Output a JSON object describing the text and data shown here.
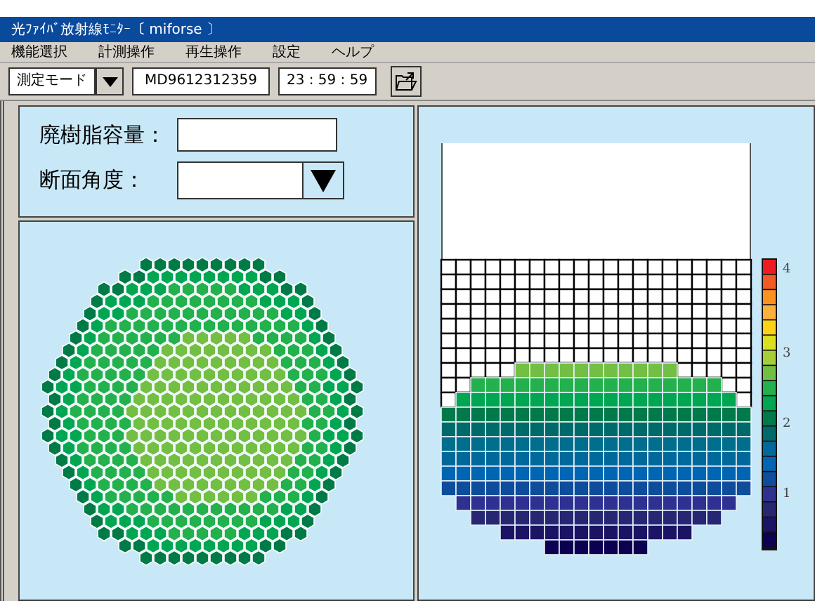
{
  "window": {
    "title": "光ﾌｧｲﾊﾞ放射線ﾓﾆﾀｰ〔 miforse 〕"
  },
  "menu": [
    {
      "label": "機能選択"
    },
    {
      "label": "計測操作"
    },
    {
      "label": "再生操作"
    },
    {
      "label": "設定"
    },
    {
      "label": "ヘルプ"
    }
  ],
  "toolbar": {
    "mode": "測定モード",
    "id": "MD9612312359",
    "time": "23 : 59 : 59"
  },
  "form": {
    "resin_label": "廃樹脂容量：",
    "angle_label": "断面角度："
  },
  "scale": {
    "labels": [
      "4",
      "3",
      "2",
      "1"
    ]
  }
}
